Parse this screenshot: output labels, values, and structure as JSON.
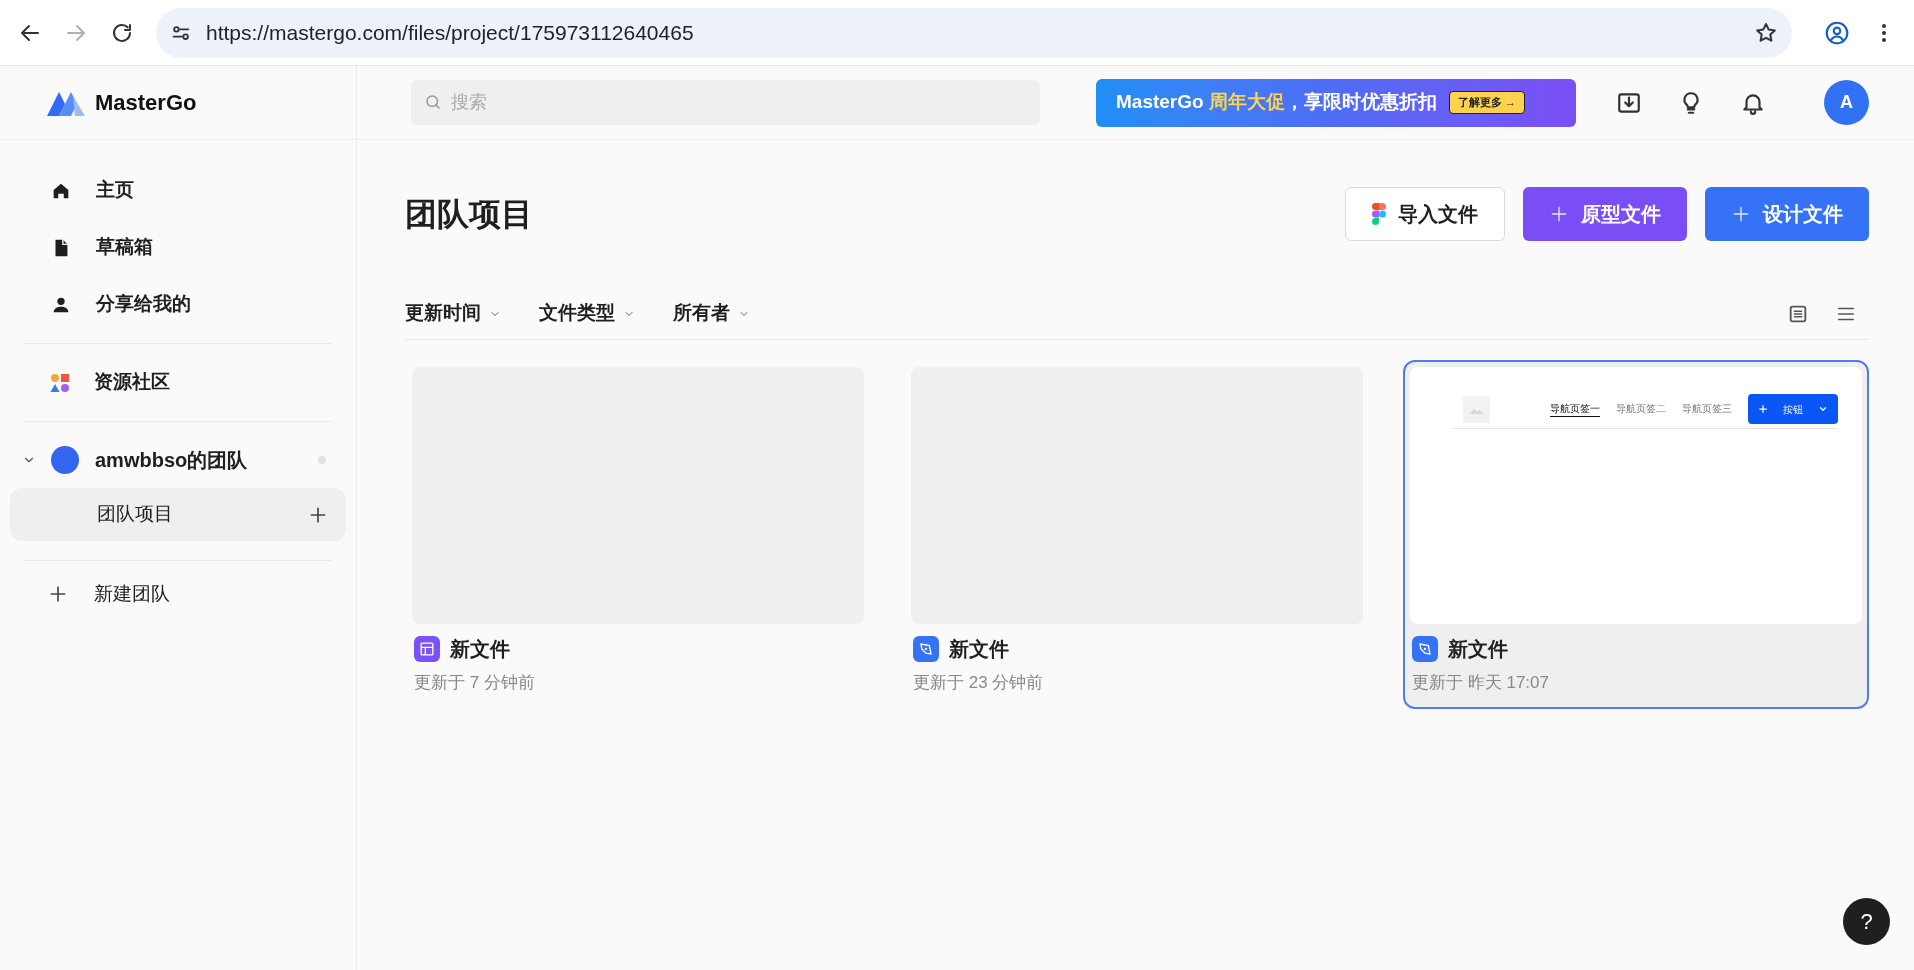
{
  "browser": {
    "url": "https://mastergo.com/files/project/175973112640465",
    "forward_enabled": false
  },
  "header": {
    "logo": "MasterGo",
    "search": {
      "placeholder": "搜索"
    },
    "promo": {
      "brand": "MasterGo",
      "highlight": "周年大促",
      "text": "，享限时优惠折扣",
      "cta": "了解更多 →"
    },
    "avatar": "A"
  },
  "sidebar": {
    "nav": [
      {
        "label": "主页",
        "kind": "home"
      },
      {
        "label": "草稿箱",
        "kind": "drafts"
      },
      {
        "label": "分享给我的",
        "kind": "shared"
      }
    ],
    "community": "资源社区",
    "team": {
      "name": "amwbbso的团队",
      "expanded": true,
      "children": [
        {
          "label": "团队项目",
          "selected": true
        }
      ]
    },
    "new_team": "新建团队"
  },
  "main": {
    "title": "团队项目",
    "actions": [
      {
        "label": "导入文件",
        "kind": "import"
      },
      {
        "label": "原型文件",
        "kind": "prototype"
      },
      {
        "label": "设计文件",
        "kind": "design"
      }
    ],
    "filters": [
      "更新时间",
      "文件类型",
      "所有者"
    ],
    "files": [
      {
        "title": "新文件",
        "kind": "prototype",
        "updated": "更新于 7 分钟前",
        "selected": false
      },
      {
        "title": "新文件",
        "kind": "design",
        "updated": "更新于 23 分钟前",
        "selected": false
      },
      {
        "title": "新文件",
        "kind": "design",
        "updated": "更新于 昨天 17:07",
        "selected": true,
        "preview": {
          "tabs": [
            {
              "label": "导航页签一",
              "selected": true
            },
            {
              "label": "导航页签二",
              "selected": false
            },
            {
              "label": "导航页签三",
              "selected": false
            }
          ],
          "button": "按钮"
        }
      }
    ]
  },
  "help": "?"
}
